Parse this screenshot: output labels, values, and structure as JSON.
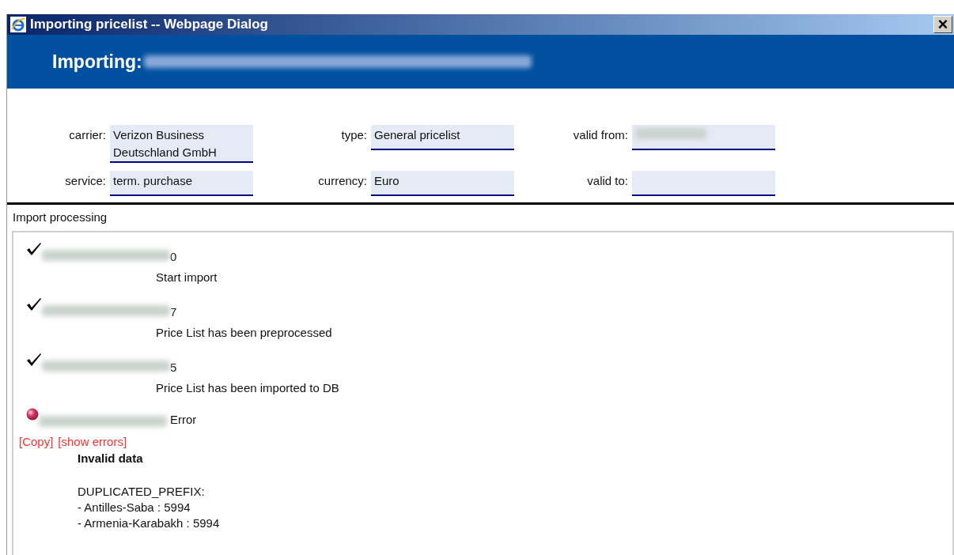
{
  "window": {
    "title": "Importing pricelist -- Webpage Dialog",
    "close": "×"
  },
  "header": {
    "label": "Importing:"
  },
  "fields": [
    {
      "label": "carrier:",
      "kind": "text",
      "value": "Verizon Business Deutschland GmbH"
    },
    {
      "label": "type:",
      "kind": "text",
      "value": "General pricelist"
    },
    {
      "label": "valid from:",
      "kind": "blurred"
    },
    {
      "label": "service:",
      "kind": "text",
      "value": "term. purchase"
    },
    {
      "label": "currency:",
      "kind": "text",
      "value": "Euro"
    },
    {
      "label": "valid to:",
      "kind": "empty"
    }
  ],
  "section": {
    "title": "Import processing"
  },
  "steps": [
    {
      "kind": "done",
      "suffix": "0",
      "message": "Start import"
    },
    {
      "kind": "done",
      "suffix": "7",
      "message": "Price List has been preprocessed"
    },
    {
      "kind": "done",
      "suffix": "5",
      "message": "Price List has been imported to DB"
    },
    {
      "kind": "error",
      "message": "Error"
    }
  ],
  "error": {
    "links": [
      "[Copy]",
      "[show errors]"
    ],
    "title": "Invalid data",
    "lines": [
      "DUPLICATED_PREFIX:",
      "- Antilles-Saba : 5994",
      "- Armenia-Karabakh : 5994"
    ]
  }
}
